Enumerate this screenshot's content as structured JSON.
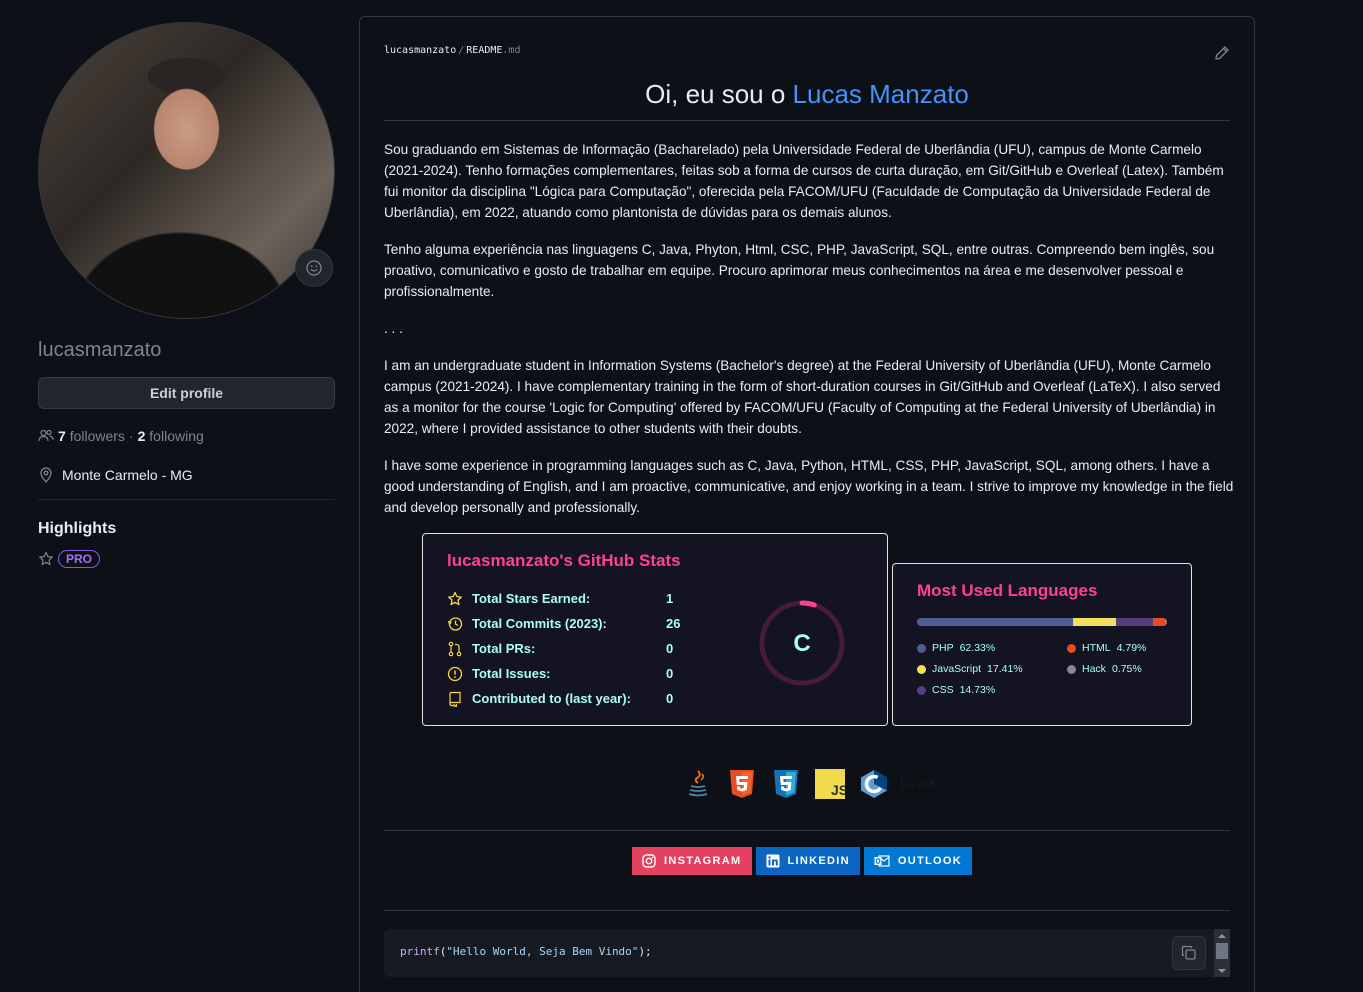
{
  "sidebar": {
    "username": "lucasmanzato",
    "edit_profile": "Edit profile",
    "followers_count": "7",
    "followers_label": "followers",
    "separator": "·",
    "following_count": "2",
    "following_label": "following",
    "location": "Monte Carmelo - MG",
    "highlights_title": "Highlights",
    "pro_badge": "PRO"
  },
  "readme": {
    "path_user": "lucasmanzato",
    "path_sep": "/",
    "path_file": "README",
    "path_ext": ".md",
    "title_prefix": "Oi, eu sou o ",
    "title_name": "Lucas Manzato",
    "paragraphs": [
      "Sou graduando em Sistemas de Informação (Bacharelado) pela Universidade Federal de Uberlândia (UFU), campus de Monte Carmelo (2021-2024). Tenho formações complementares, feitas sob a forma de cursos de curta duração, em Git/GitHub e Overleaf (Latex). Também fui monitor da disciplina \"Lógica para Computação\", oferecida pela FACOM/UFU (Faculdade de Computação da Universidade Federal de Uberlândia), em 2022, atuando como plantonista de dúvidas para os demais alunos.",
      "Tenho alguma experiência nas linguagens C, Java, Phyton, Html, CSC, PHP, JavaScript, SQL, entre outras. Compreendo bem inglês, sou proativo, comunicativo e gosto de trabalhar em equipe. Procuro aprimorar meus conhecimentos na área e me desenvolver pessoal e profissionalmente.",
      ". . .",
      "I am an undergraduate student in Information Systems (Bachelor's degree) at the Federal University of Uberlândia (UFU), Monte Carmelo campus (2021-2024). I have complementary training in the form of short-duration courses in Git/GitHub and Overleaf (LaTeX). I also served as a monitor for the course 'Logic for Computing' offered by FACOM/UFU (Faculty of Computing at the Federal University of Uberlândia) in 2022, where I provided assistance to other students with their doubts.",
      "I have some experience in programming languages such as C, Java, Python, HTML, CSS, PHP, JavaScript, SQL, among others. I have a good understanding of English, and I am proactive, communicative, and enjoy working in a team. I strive to improve my knowledge in the field and develop personally and professionally."
    ],
    "stats": {
      "title": "lucasmanzato's GitHub Stats",
      "rows": [
        {
          "label": "Total Stars Earned:",
          "value": "1",
          "icon": "star-icon"
        },
        {
          "label": "Total Commits (2023):",
          "value": "26",
          "icon": "history-icon"
        },
        {
          "label": "Total PRs:",
          "value": "0",
          "icon": "pull-request-icon"
        },
        {
          "label": "Total Issues:",
          "value": "0",
          "icon": "issue-icon"
        },
        {
          "label": "Contributed to (last year):",
          "value": "0",
          "icon": "repo-icon"
        }
      ],
      "rank": "C",
      "rank_progress": 0.05
    },
    "languages": {
      "title": "Most Used Languages",
      "items": [
        {
          "name": "PHP",
          "percent": "62.33%",
          "value": 62.33,
          "color": "#4F5D95"
        },
        {
          "name": "JavaScript",
          "percent": "17.41%",
          "value": 17.41,
          "color": "#f1e05a"
        },
        {
          "name": "CSS",
          "percent": "14.73%",
          "value": 14.73,
          "color": "#563d7c"
        },
        {
          "name": "HTML",
          "percent": "4.79%",
          "value": 4.79,
          "color": "#e34c26"
        },
        {
          "name": "Hack",
          "percent": "0.75%",
          "value": 0.75,
          "color": "#878787"
        }
      ]
    },
    "tech_icons": [
      "java-icon",
      "html5-icon",
      "css3-icon",
      "javascript-icon",
      "c-language-icon",
      "latex-icon"
    ],
    "latex_text": "LaTeX",
    "social": [
      {
        "label": "INSTAGRAM",
        "color": "#E4405F",
        "icon": "instagram-icon"
      },
      {
        "label": "LINKEDIN",
        "color": "#0A66C2",
        "icon": "linkedin-icon"
      },
      {
        "label": "OUTLOOK",
        "color": "#0078D4",
        "icon": "outlook-icon"
      }
    ],
    "code_fn": "printf",
    "code_open": "(",
    "code_string": "\"Hello World, Seja Bem Vindo\"",
    "code_close": ");"
  }
}
